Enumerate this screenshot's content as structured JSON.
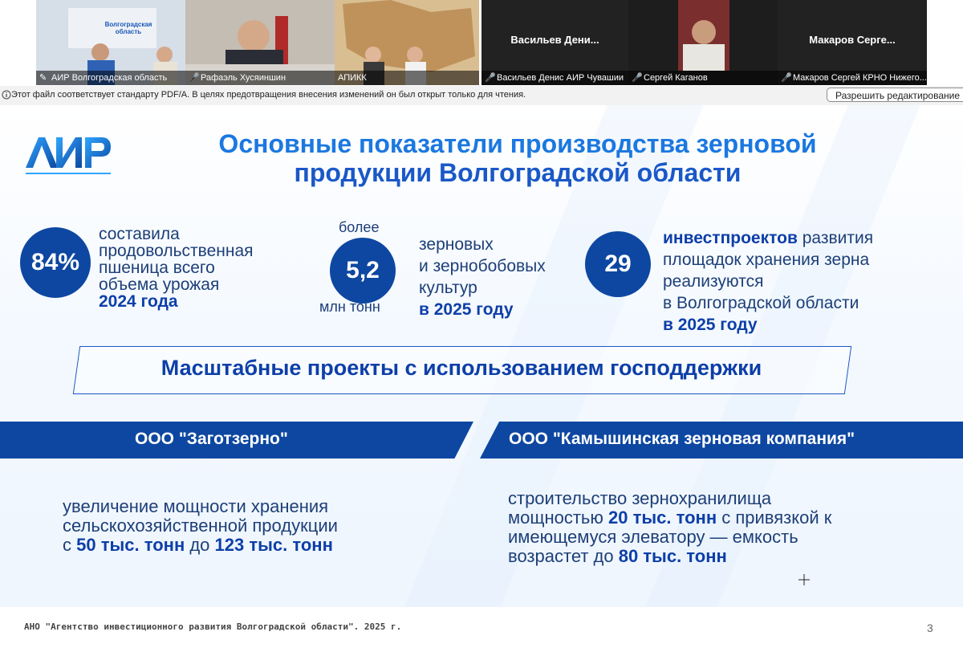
{
  "video_tiles": [
    {
      "name": "АИР Волгоградская область",
      "muted": false,
      "pinned": true,
      "scene_text": "Волгоградская область"
    },
    {
      "name": "Рафаэль Хусяиншин",
      "muted": true
    },
    {
      "name": "АПИКК",
      "muted": false
    },
    {
      "name": "Васильев Денис АИР Чувашии",
      "muted": true,
      "display_name": "Васильев  Дени..."
    },
    {
      "name": "Сергей Каганов",
      "muted": true
    },
    {
      "name": "Макаров Сергей КРНО Нижего...",
      "muted": true,
      "display_name": "Макаров  Серге..."
    }
  ],
  "pdf_notice": {
    "message": "Этот файл соответствует стандарту PDF/A. В целях предотвращения внесения изменений он был открыт только для чтения.",
    "enable_editing_label": "Разрешить редактирование"
  },
  "slide": {
    "logo_text": "АИР",
    "title_line1": "Основные показатели производства зерновой",
    "title_line2": "продукции Волгоградской области",
    "stats": [
      {
        "value": "84%",
        "text_lines": [
          "составила",
          "продовольственная",
          "пшеница всего",
          "объема урожая"
        ],
        "highlight": "2024 года"
      },
      {
        "top_label": "более",
        "value": "5,2",
        "bottom_label": "млн тонн",
        "text_lines": [
          "зерновых",
          "и зернобобовых",
          "культур"
        ],
        "highlight": "в 2025 году"
      },
      {
        "value": "29",
        "lead_highlight": "инвестпроектов",
        "lead_rest": " развития",
        "text_lines": [
          "площадок хранения зерна",
          "реализуются",
          "в Волгоградской области"
        ],
        "highlight": "в 2025 году"
      }
    ],
    "subtitle": "Масштабные проекты с использованием господдержки",
    "projects": [
      {
        "company": "ООО \"Заготзерно\"",
        "line1": "увеличение мощности хранения",
        "line2": "сельскохозяйственной продукции",
        "line3_pre": "с ",
        "line3_h1": "50 тыс. тонн",
        "line3_mid": " до ",
        "line3_h2": "123 тыс. тонн"
      },
      {
        "company": "ООО \"Камышинская зерновая компания\"",
        "line1": "строительство зернохранилища",
        "line2_pre": "мощностью ",
        "line2_h": "20 тыс. тонн",
        "line2_post": " с привязкой к",
        "line3": "имеющемуся элеватору — емкость",
        "line4_pre": "возрастет до ",
        "line4_h": "80 тыс. тонн"
      }
    ],
    "footer": "АНО \"Агентство инвестиционного развития Волгоградской области\". 2025 г.",
    "page_number": "3"
  },
  "colors": {
    "primary_dark_blue": "#0d47a1",
    "title_blue": "#1b78e0",
    "text_navy": "#1d3f78",
    "active_speaker_border": "#27c93f",
    "muted_icon": "#ff4b4b"
  }
}
